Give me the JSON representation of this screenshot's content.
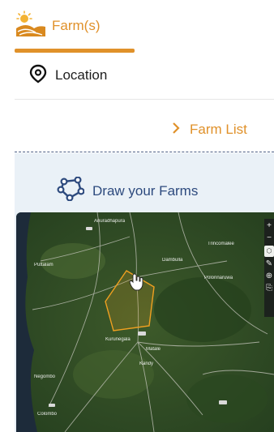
{
  "tabs": {
    "farms_label": "Farm(s)",
    "location_label": "Location"
  },
  "farm_list_label": "Farm List",
  "draw_farms_label": "Draw your Farms",
  "map": {
    "toolbar": [
      "+",
      "−",
      "⬡",
      "✎",
      "⊕",
      "⎘"
    ],
    "labels": [
      "Anuradhapura",
      "Kurunegala",
      "Kandy",
      "Negombo",
      "Colombo",
      "Dambulla",
      "Matale",
      "Puttalam",
      "Trincomalee",
      "Polonnaruwa"
    ]
  },
  "colors": {
    "accent": "#e0912a",
    "navy": "#2d4a7e",
    "panel_bg": "#eaf1f7",
    "polygon": "#f0a020"
  }
}
